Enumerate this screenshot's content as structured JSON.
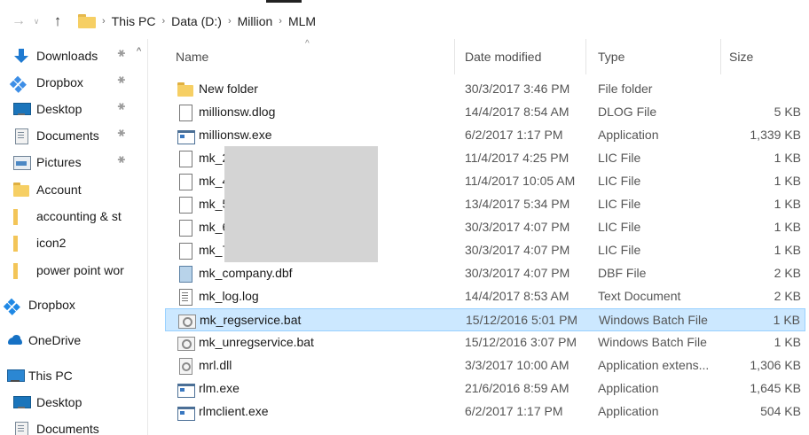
{
  "window": {
    "breadcrumb": [
      "This PC",
      "Data (D:)",
      "Million",
      "MLM"
    ],
    "nav_back_symbol": "→",
    "nav_history_symbol": "∨",
    "nav_up_symbol": "↑"
  },
  "navpane": {
    "items": [
      {
        "label": "Downloads",
        "icon": "download-icon",
        "pinned": true
      },
      {
        "label": "Dropbox",
        "icon": "dropbox-icon",
        "pinned": true
      },
      {
        "label": "Desktop",
        "icon": "desktop-icon",
        "pinned": true
      },
      {
        "label": "Documents",
        "icon": "documents-icon",
        "pinned": true
      },
      {
        "label": "Pictures",
        "icon": "pictures-icon",
        "pinned": true
      },
      {
        "label": "Account",
        "icon": "folder-icon",
        "pinned": false
      },
      {
        "label": "accounting & st",
        "icon": "folder-icon",
        "pinned": false
      },
      {
        "label": "icon2",
        "icon": "folder-icon",
        "pinned": false
      },
      {
        "label": "power point wor",
        "icon": "folder-icon",
        "pinned": false
      }
    ],
    "roots": [
      {
        "label": "Dropbox",
        "icon": "dropbox-icon"
      },
      {
        "label": "OneDrive",
        "icon": "onedrive-icon"
      },
      {
        "label": "This PC",
        "icon": "computer-icon"
      }
    ],
    "thispc_children": [
      {
        "label": "Desktop",
        "icon": "desktop-icon"
      },
      {
        "label": "Documents",
        "icon": "documents-icon"
      }
    ]
  },
  "columns": {
    "name": "Name",
    "date": "Date modified",
    "type": "Type",
    "size": "Size"
  },
  "files": [
    {
      "name": "New folder",
      "date": "30/3/2017 3:46 PM",
      "type": "File folder",
      "size": "",
      "icon": "folder-icon"
    },
    {
      "name": "millionsw.dlog",
      "date": "14/4/2017 8:54 AM",
      "type": "DLOG File",
      "size": "5 KB",
      "icon": "blank-file-icon"
    },
    {
      "name": "millionsw.exe",
      "date": "6/2/2017 1:17 PM",
      "type": "Application",
      "size": "1,339 KB",
      "icon": "application-icon"
    },
    {
      "name": "mk_2",
      "date": "11/4/2017 4:25 PM",
      "type": "LIC File",
      "size": "1 KB",
      "icon": "blank-file-icon"
    },
    {
      "name": "mk_4",
      "date": "11/4/2017 10:05 AM",
      "type": "LIC File",
      "size": "1 KB",
      "icon": "blank-file-icon"
    },
    {
      "name": "mk_5",
      "date": "13/4/2017 5:34 PM",
      "type": "LIC File",
      "size": "1 KB",
      "icon": "blank-file-icon"
    },
    {
      "name": "mk_6",
      "date": "30/3/2017 4:07 PM",
      "type": "LIC File",
      "size": "1 KB",
      "icon": "blank-file-icon"
    },
    {
      "name": "mk_7",
      "date": "30/3/2017 4:07 PM",
      "type": "LIC File",
      "size": "1 KB",
      "icon": "blank-file-icon"
    },
    {
      "name": "mk_company.dbf",
      "date": "30/3/2017 4:07 PM",
      "type": "DBF File",
      "size": "2 KB",
      "icon": "database-file-icon"
    },
    {
      "name": "mk_log.log",
      "date": "14/4/2017 8:53 AM",
      "type": "Text Document",
      "size": "2 KB",
      "icon": "text-document-icon"
    },
    {
      "name": "mk_regservice.bat",
      "date": "15/12/2016 5:01 PM",
      "type": "Windows Batch File",
      "size": "1 KB",
      "icon": "batch-file-icon",
      "selected": true
    },
    {
      "name": "mk_unregservice.bat",
      "date": "15/12/2016 3:07 PM",
      "type": "Windows Batch File",
      "size": "1 KB",
      "icon": "batch-file-icon"
    },
    {
      "name": "mrl.dll",
      "date": "3/3/2017 10:00 AM",
      "type": "Application extens...",
      "size": "1,306 KB",
      "icon": "dll-file-icon"
    },
    {
      "name": "rlm.exe",
      "date": "21/6/2016 8:59 AM",
      "type": "Application",
      "size": "1,645 KB",
      "icon": "application-icon"
    },
    {
      "name": "rlmclient.exe",
      "date": "6/2/2017 1:17 PM",
      "type": "Application",
      "size": "504 KB",
      "icon": "application-icon"
    }
  ],
  "colors": {
    "selected_row": "#cce8ff",
    "selected_border": "#99d1ff",
    "folder": "#f6cf64",
    "accent": "#1f7ad1"
  }
}
